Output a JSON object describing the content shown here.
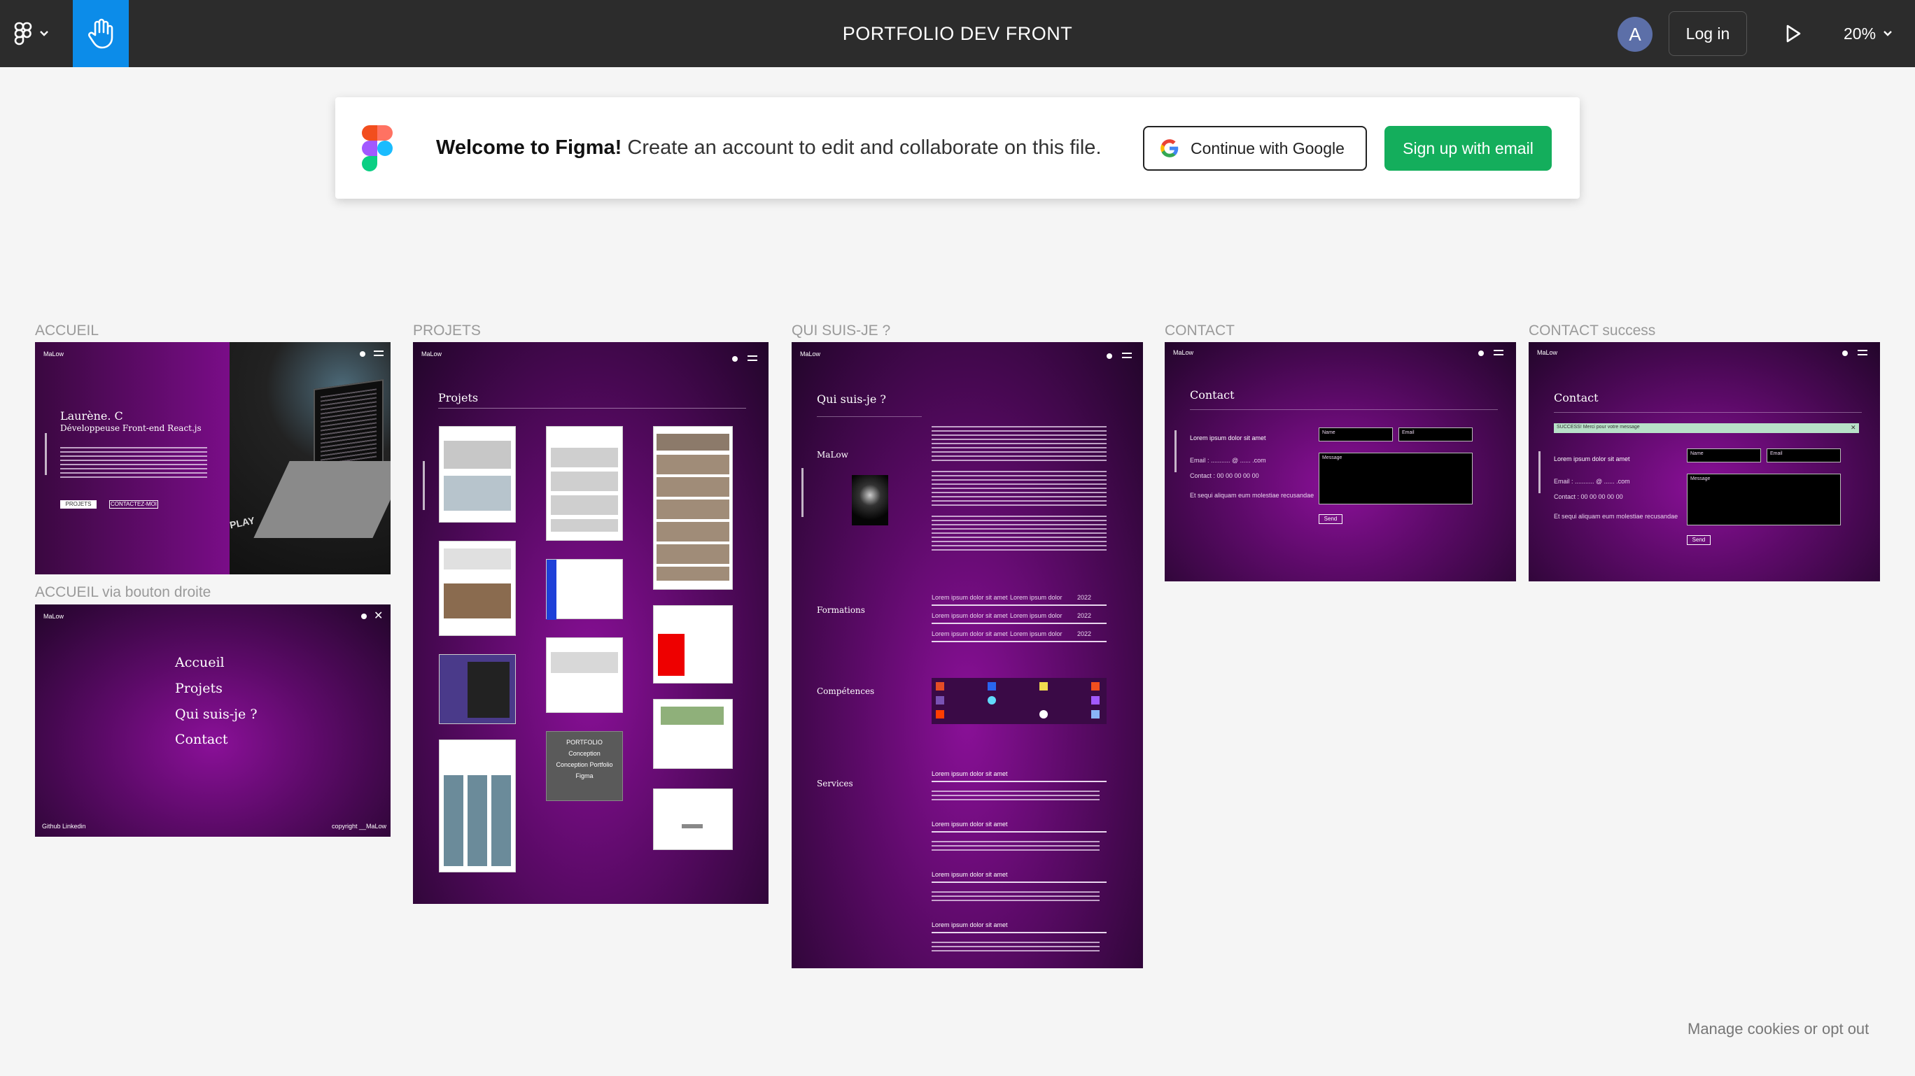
{
  "topbar": {
    "file_title": "PORTFOLIO DEV FRONT",
    "avatar_initial": "A",
    "login_label": "Log in",
    "zoom_level": "20%"
  },
  "banner": {
    "welcome_bold": "Welcome to Figma!",
    "welcome_rest": " Create an account to edit and collaborate on this file.",
    "google_label": "Continue with Google",
    "email_label": "Sign up with email"
  },
  "frames": {
    "accueil": {
      "label": "ACCUEIL",
      "brand": "MaLow",
      "name": "Laurène. C",
      "role": "Développeuse Front-end React.js",
      "btn_projets": "PROJETS",
      "btn_contact": "CONTACTEZ-MOI",
      "play_text": "PLAY"
    },
    "accueil_menu": {
      "label": "ACCUEIL via bouton droite",
      "brand": "MaLow",
      "menu": [
        "Accueil",
        "Projets",
        "Qui suis-je ?",
        "Contact"
      ],
      "footer_left": "Github   Linkedin",
      "footer_right": "copyright __MaLow"
    },
    "projets": {
      "label": "PROJETS",
      "brand": "MaLow",
      "heading": "Projets",
      "portfolio_card": [
        "PORTFOLIO",
        "Conception",
        "Conception Portfolio",
        "Figma"
      ]
    },
    "qui": {
      "label": "QUI SUIS-JE ?",
      "brand": "MaLow",
      "heading": "Qui suis-je ?",
      "side_name": "MaLow",
      "formations": "Formations",
      "competences": "Compétences",
      "services": "Services",
      "formation_rows": [
        {
          "a": "Lorem ipsum dolor sit amet",
          "b": "Lorem ipsum dolor",
          "c": "2022"
        },
        {
          "a": "Lorem ipsum dolor sit amet",
          "b": "Lorem ipsum dolor",
          "c": "2022"
        },
        {
          "a": "Lorem ipsum dolor sit amet",
          "b": "Lorem ipsum dolor",
          "c": "2022"
        }
      ],
      "service_title": "Lorem ipsum dolor sit amet"
    },
    "contact": {
      "label": "CONTACT",
      "brand": "MaLow",
      "heading": "Contact",
      "intro": "Lorem ipsum dolor sit amet",
      "email": "Email : ........... @ ...... .com",
      "phone": "Contact : 00 00 00 00 00",
      "note": "Et sequi aliquam eum molestiae recusandae",
      "ph_name": "Name",
      "ph_email": "Email",
      "ph_message": "Message",
      "send": "Send"
    },
    "contact_success": {
      "label": "CONTACT success",
      "brand": "MaLow",
      "heading": "Contact",
      "success_msg": "SUCCESS! Merci pour votre message",
      "intro": "Lorem ipsum dolor sit amet",
      "email": "Email : ........... @ ...... .com",
      "phone": "Contact : 00 00 00 00 00",
      "note": "Et sequi aliquam eum molestiae recusandae",
      "ph_name": "Name",
      "ph_email": "Email",
      "ph_message": "Message",
      "send": "Send"
    }
  },
  "cookies_link": "Manage cookies or opt out",
  "colors": {
    "topbar": "#2c2c2c",
    "hand_tool_active": "#0c8ce9",
    "signup_green": "#14ae5c",
    "canvas": "#f5f5f5",
    "frame_purple": "#8a1098"
  }
}
